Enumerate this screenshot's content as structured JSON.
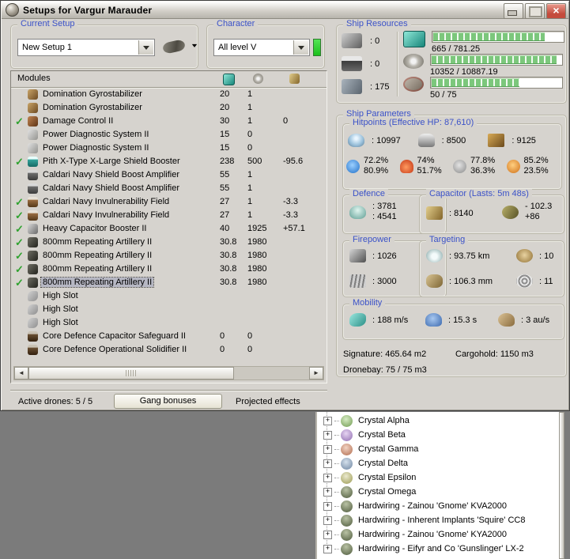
{
  "colors": {
    "accent_blue": "#3b52c8",
    "window_bg": "#d6d3ce",
    "desktop_gray": "#7b7b7b",
    "check_green": "#2fa22f",
    "bar_green": "#7cc77c",
    "character_bar_green": "#1cc01c",
    "selection_gray": "#b6b7c3",
    "close_red": "#c44b3c"
  },
  "window": {
    "title": "Setups for Vargur Marauder"
  },
  "setup": {
    "label": "Current Setup",
    "value": "New Setup 1"
  },
  "character": {
    "label": "Character",
    "value": "All level V"
  },
  "resources": {
    "label": "Ship Resources",
    "slots": [
      {
        "icon": "turret",
        "value": ": 0"
      },
      {
        "icon": "launcher",
        "value": ": 0"
      },
      {
        "icon": "calibration",
        "value": ": 175"
      }
    ],
    "bars": [
      {
        "icon": "cpu",
        "text": "665 / 781.25",
        "fill": "85%"
      },
      {
        "icon": "powergrid",
        "text": "10352 / 10887.19",
        "fill": "95%"
      },
      {
        "icon": "dronebw",
        "text": "50 / 75",
        "fill": "67%"
      }
    ]
  },
  "modules": {
    "title": "Modules",
    "rows": [
      {
        "check": "",
        "icon": "icon-gyro",
        "name": "Domination Gyrostabilizer",
        "cpu": "20",
        "pg": "1",
        "cap": "",
        "state": ""
      },
      {
        "check": "",
        "icon": "icon-gyro",
        "name": "Domination Gyrostabilizer",
        "cpu": "20",
        "pg": "1",
        "cap": "",
        "state": ""
      },
      {
        "check": "on",
        "icon": "icon-dcu",
        "name": "Damage Control II",
        "cpu": "30",
        "pg": "1",
        "cap": "0",
        "state": ""
      },
      {
        "check": "",
        "icon": "icon-pds",
        "name": "Power Diagnostic System II",
        "cpu": "15",
        "pg": "0",
        "cap": "",
        "state": ""
      },
      {
        "check": "",
        "icon": "icon-pds",
        "name": "Power Diagnostic System II",
        "cpu": "15",
        "pg": "0",
        "cap": "",
        "state": ""
      },
      {
        "check": "on",
        "icon": "icon-sb",
        "name": "Pith X-Type X-Large Shield Booster",
        "cpu": "238",
        "pg": "500",
        "cap": "-95.6",
        "state": ""
      },
      {
        "check": "",
        "icon": "icon-sba",
        "name": "Caldari Navy Shield Boost Amplifier",
        "cpu": "55",
        "pg": "1",
        "cap": "",
        "state": ""
      },
      {
        "check": "",
        "icon": "icon-sba",
        "name": "Caldari Navy Shield Boost Amplifier",
        "cpu": "55",
        "pg": "1",
        "cap": "",
        "state": ""
      },
      {
        "check": "on",
        "icon": "icon-invuln",
        "name": "Caldari Navy Invulnerability Field",
        "cpu": "27",
        "pg": "1",
        "cap": "-3.3",
        "state": ""
      },
      {
        "check": "on",
        "icon": "icon-invuln",
        "name": "Caldari Navy Invulnerability Field",
        "cpu": "27",
        "pg": "1",
        "cap": "-3.3",
        "state": ""
      },
      {
        "check": "on",
        "icon": "icon-capbooster",
        "name": "Heavy Capacitor Booster II",
        "cpu": "40",
        "pg": "1925",
        "cap": "+57.1",
        "state": ""
      },
      {
        "check": "on",
        "icon": "icon-arty",
        "name": "800mm Repeating Artillery II",
        "cpu": "30.8",
        "pg": "1980",
        "cap": "",
        "state": ""
      },
      {
        "check": "on",
        "icon": "icon-arty",
        "name": "800mm Repeating Artillery II",
        "cpu": "30.8",
        "pg": "1980",
        "cap": "",
        "state": ""
      },
      {
        "check": "on",
        "icon": "icon-arty",
        "name": "800mm Repeating Artillery II",
        "cpu": "30.8",
        "pg": "1980",
        "cap": "",
        "state": ""
      },
      {
        "check": "on",
        "icon": "icon-arty",
        "name": "800mm Repeating Artillery II",
        "cpu": "30.8",
        "pg": "1980",
        "cap": "",
        "state": "selected"
      },
      {
        "check": "",
        "icon": "icon-highslot",
        "name": "High Slot",
        "cpu": "",
        "pg": "",
        "cap": "",
        "state": ""
      },
      {
        "check": "",
        "icon": "icon-highslot",
        "name": "High Slot",
        "cpu": "",
        "pg": "",
        "cap": "",
        "state": ""
      },
      {
        "check": "",
        "icon": "icon-highslot",
        "name": "High Slot",
        "cpu": "",
        "pg": "",
        "cap": "",
        "state": ""
      },
      {
        "check": "",
        "icon": "icon-rig",
        "name": "Core Defence Capacitor Safeguard II",
        "cpu": "0",
        "pg": "0",
        "cap": "",
        "state": ""
      },
      {
        "check": "",
        "icon": "icon-rig",
        "name": "Core Defence Operational Solidifier II",
        "cpu": "0",
        "pg": "0",
        "cap": "",
        "state": ""
      }
    ]
  },
  "footer": {
    "active_drones": "Active drones: 5 / 5",
    "gang_button": "Gang bonuses",
    "projected": "Projected effects"
  },
  "params": {
    "label": "Ship Parameters",
    "hitpoints": {
      "label": "Hitpoints (Effective HP: 87,610)",
      "shield": ": 10997",
      "armor": ": 8500",
      "structure": ": 9125",
      "resists": [
        {
          "icon": "em",
          "top": "72.2%",
          "bottom": "80.9%"
        },
        {
          "icon": "thermal",
          "top": "74%",
          "bottom": "51.7%"
        },
        {
          "icon": "kinetic",
          "top": "77.8%",
          "bottom": "36.3%"
        },
        {
          "icon": "explosive",
          "top": "85.2%",
          "bottom": "23.5%"
        }
      ]
    },
    "defence": {
      "label": "Defence",
      "v1": ": 3781",
      "v2": ": 4541"
    },
    "capacitor": {
      "label": "Capacitor (Lasts: 5m 48s)",
      "amount": ": 8140",
      "delta_top": "- 102.3",
      "delta_bottom": "+86"
    },
    "firepower": {
      "label": "Firepower",
      "dps": ": 1026",
      "volley": ": 3000"
    },
    "targeting": {
      "label": "Targeting",
      "range": ": 93.75 km",
      "max_targets": ": 10",
      "sig_radius": ": 106.3 mm",
      "scan_res": ": 11"
    },
    "mobility": {
      "label": "Mobility",
      "speed": ": 188 m/s",
      "align": ": 15.3 s",
      "warp": ": 3 au/s"
    },
    "signature": "Signature: 465.64 m2",
    "cargohold": "Cargohold: 1150 m3",
    "dronebay": "Dronebay: 75 / 75 m3"
  },
  "tree": {
    "items": [
      {
        "icon": "skull-green",
        "label": "Crystal Alpha"
      },
      {
        "icon": "skull-purple",
        "label": "Crystal Beta"
      },
      {
        "icon": "skull-red",
        "label": "Crystal Gamma"
      },
      {
        "icon": "skull-blue",
        "label": "Crystal Delta"
      },
      {
        "icon": "skull-yellow",
        "label": "Crystal Epsilon"
      },
      {
        "icon": "skull-dark",
        "label": "Crystal Omega"
      },
      {
        "icon": "skull-dark",
        "label": "Hardwiring - Zainou 'Gnome' KVA2000"
      },
      {
        "icon": "skull-dark",
        "label": "Hardwiring - Inherent Implants 'Squire' CC8"
      },
      {
        "icon": "skull-dark",
        "label": "Hardwiring - Zainou 'Gnome' KYA2000"
      },
      {
        "icon": "skull-dark",
        "label": "Hardwiring - Eifyr and Co 'Gunslinger' LX-2"
      }
    ]
  }
}
